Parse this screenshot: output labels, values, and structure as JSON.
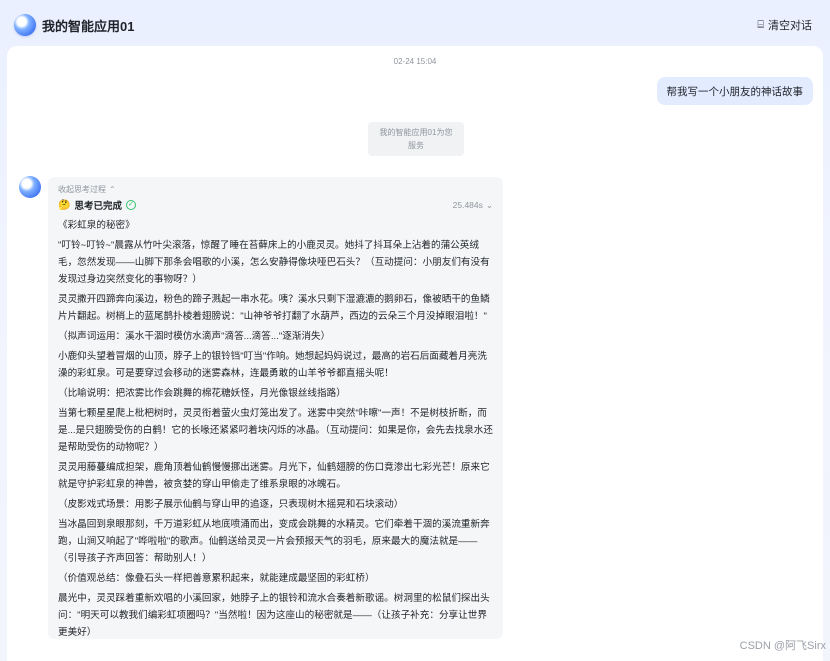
{
  "header": {
    "app_title": "我的智能应用01",
    "clear_label": "清空对话"
  },
  "chat": {
    "timestamp": "02-24 15:04",
    "user_message": "帮我写一个小朋友的神话故事",
    "service_line1": "我的智能应用01为您",
    "service_line2": "服务",
    "thinking": {
      "collapse_label": "收起思考过程",
      "status": "思考已完成",
      "duration": "25.484s"
    },
    "story": [
      "《彩虹泉的秘密》",
      "\"叮铃~叮铃~\"晨露从竹叶尖滚落，惊醒了睡在苔藓床上的小鹿灵灵。她抖了抖耳朵上沾着的蒲公英绒毛，忽然发现——山脚下那条会唱歌的小溪，怎么安静得像块哑巴石头？（互动提问：小朋友们有没有发现过身边突然变化的事物呀？）",
      "灵灵撒开四蹄奔向溪边，粉色的蹄子溅起一串水花。咦？溪水只剩下湿漉漉的鹅卵石，像被晒干的鱼鳞片片翻起。树梢上的蓝尾鹊扑棱着翅膀说：\"山神爷爷打翻了水葫芦，西边的云朵三个月没掉眼泪啦！\"",
      "（拟声词运用：溪水干涸时模仿水滴声\"滴答...滴答...\"逐渐消失）",
      "小鹿仰头望着冒烟的山顶，脖子上的银铃铛\"叮当\"作响。她想起妈妈说过，最高的岩石后面藏着月亮洗澡的彩虹泉。可是要穿过会移动的迷雾森林，连最勇敢的山羊爷爷都直摇头呢！",
      "（比喻说明：把浓雾比作会跳舞的棉花糖妖怪，月光像银丝线指路）",
      "当第七颗星星爬上枇杷树时，灵灵衔着萤火虫灯笼出发了。迷雾中突然\"咔嚓\"一声！不是树枝折断，而是...是只翅膀受伤的白鹤！它的长喙还紧紧叼着块闪烁的冰晶。（互动提问：如果是你，会先去找泉水还是帮助受伤的动物呢？）",
      "灵灵用藤蔓编成担架，鹿角顶着仙鹤慢慢挪出迷雾。月光下，仙鹤翅膀的伤口竟渗出七彩光芒！原来它就是守护彩虹泉的神兽，被贪婪的穿山甲偷走了维系泉眼的冰魄石。",
      "（皮影戏式场景：用影子展示仙鹤与穿山甲的追逐，只表现树木摇晃和石块滚动）",
      "当冰晶回到泉眼那刻，千万道彩虹从地底喷涌而出，变成会跳舞的水精灵。它们牵着干涸的溪流重新奔跑，山涧又响起了\"哗啦啦\"的歌声。仙鹤送给灵灵一片会预报天气的羽毛，原来最大的魔法就是——（引导孩子齐声回答：帮助别人！）",
      "（价值观总结：像叠石头一样把善意累积起来，就能建成最坚固的彩虹桥）",
      "晨光中，灵灵踩着重新欢唱的小溪回家，她脖子上的银铃和流水合奏着新歌谣。树洞里的松鼠们探出头问：\"明天可以教我们编彩虹项圈吗？\"当然啦！因为这座山的秘密就是——（让孩子补充：分享让世界更美好）"
    ]
  },
  "watermark": "CSDN @阿飞Sirx",
  "icons": {
    "clear": "broom-icon",
    "check": "check-circle-icon",
    "chevron": "chevron-icon"
  }
}
